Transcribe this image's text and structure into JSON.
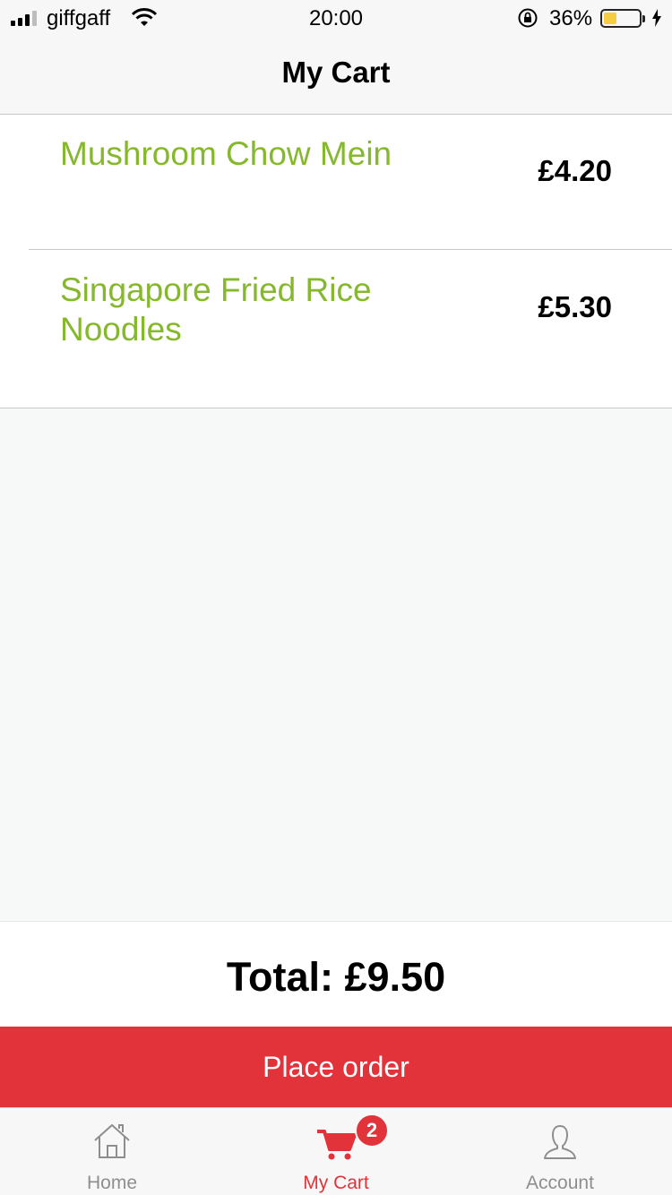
{
  "status_bar": {
    "carrier": "giffgaff",
    "time": "20:00",
    "battery_percent": "36%",
    "battery_level": 0.36,
    "battery_color": "#f5c623",
    "icons": [
      "signal-icon",
      "wifi-icon",
      "orientation-lock-icon",
      "battery-icon",
      "charging-bolt-icon"
    ]
  },
  "nav": {
    "title": "My Cart"
  },
  "cart": {
    "items": [
      {
        "name": "Mushroom Chow Mein",
        "price": "£4.20"
      },
      {
        "name": "Singapore Fried Rice Noodles",
        "price": "£5.30"
      }
    ]
  },
  "total": {
    "label": "Total: £9.50"
  },
  "actions": {
    "place_order": "Place order"
  },
  "tabbar": {
    "tabs": [
      {
        "label": "Home",
        "icon": "home-icon"
      },
      {
        "label": "My Cart",
        "icon": "cart-icon",
        "badge": "2",
        "active": true
      },
      {
        "label": "Account",
        "icon": "account-icon"
      }
    ]
  },
  "colors": {
    "accent": "#e2333b",
    "item_name": "#86b82e",
    "tab_inactive": "#8e8e8e"
  }
}
